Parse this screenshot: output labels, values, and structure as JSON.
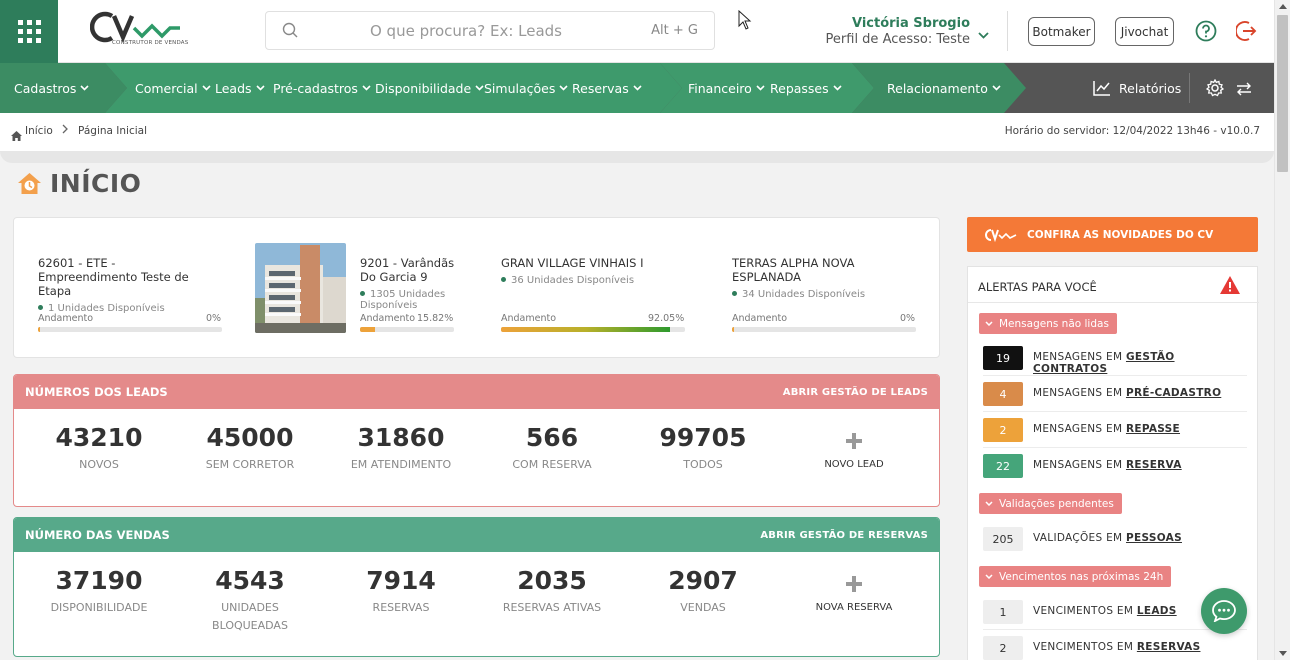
{
  "header": {
    "search_placeholder": "O que procura? Ex: Leads",
    "search_shortcut": "Alt + G",
    "logo_tagline": "CONSTRUTOR DE VENDAS",
    "user_name": "Victória Sbrogio",
    "user_profile": "Perfil de Acesso: Teste",
    "botmaker_label": "Botmaker",
    "jivochat_label": "Jivochat"
  },
  "nav": {
    "items": [
      "Cadastros",
      "Comercial",
      "Leads",
      "Pré-cadastros",
      "Disponibilidade",
      "Simulações",
      "Reservas",
      "Financeiro",
      "Repasses",
      "Relacionamento"
    ],
    "reports_label": "Relatórios"
  },
  "breadcrumb": {
    "home": "Início",
    "current": "Página Inicial",
    "server_time": "Horário do servidor: 12/04/2022 13h46 - v10.0.7"
  },
  "page": {
    "title": "INÍCIO"
  },
  "projects": [
    {
      "name": "62601 - ETE - Empreendimento Teste de Etapa",
      "units": "1 Unidades Disponíveis",
      "progress_label": "Andamento",
      "progress_text": "0%",
      "progress": 0.0
    },
    {
      "name": "9201 - Varândãs Do Garcia 9",
      "units": "1305 Unidades Disponíveis",
      "progress_label": "Andamento",
      "progress_text": "15.82%",
      "progress": 0.1582
    },
    {
      "name": "GRAN VILLAGE VINHAIS I",
      "units": "36 Unidades Disponíveis",
      "progress_label": "Andamento",
      "progress_text": "92.05%",
      "progress": 0.9205
    },
    {
      "name": "TERRAS ALPHA NOVA ESPLANADA",
      "units": "34 Unidades Disponíveis",
      "progress_label": "Andamento",
      "progress_text": "0%",
      "progress": 0.0
    }
  ],
  "leads": {
    "title": "NÚMEROS DOS LEADS",
    "link": "ABRIR GESTÃO DE LEADS",
    "stats": [
      {
        "value": "43210",
        "label": "NOVOS"
      },
      {
        "value": "45000",
        "label": "SEM CORRETOR"
      },
      {
        "value": "31860",
        "label": "EM ATENDIMENTO"
      },
      {
        "value": "566",
        "label": "COM RESERVA"
      },
      {
        "value": "99705",
        "label": "TODOS"
      }
    ],
    "new_label": "NOVO LEAD"
  },
  "sales": {
    "title": "NÚMERO DAS VENDAS",
    "link": "ABRIR GESTÃO DE RESERVAS",
    "stats": [
      {
        "value": "37190",
        "label": "DISPONIBILIDADE"
      },
      {
        "value": "4543",
        "label": "UNIDADES BLOQUEADAS"
      },
      {
        "value": "7914",
        "label": "RESERVAS"
      },
      {
        "value": "2035",
        "label": "RESERVAS ATIVAS"
      },
      {
        "value": "2907",
        "label": "VENDAS"
      }
    ],
    "new_label": "NOVA RESERVA"
  },
  "news_button": "CONFIRA AS NOVIDADES DO CV",
  "alerts": {
    "title": "ALERTAS PARA VOCÊ",
    "groups": [
      {
        "label": "Mensagens não lidas",
        "rows": [
          {
            "count": "19",
            "prefix": "MENSAGENS EM",
            "target": "GESTÃO CONTRATOS",
            "color": "#111111"
          },
          {
            "count": "4",
            "prefix": "MENSAGENS EM",
            "target": "PRÉ-CADASTRO",
            "color": "#d98b4a"
          },
          {
            "count": "2",
            "prefix": "MENSAGENS EM",
            "target": "REPASSE",
            "color": "#eda23a"
          },
          {
            "count": "22",
            "prefix": "MENSAGENS EM",
            "target": "RESERVA",
            "color": "#45a57a"
          }
        ]
      },
      {
        "label": "Validações pendentes",
        "rows": [
          {
            "count": "205",
            "prefix": "VALIDAÇÕES EM",
            "target": "PESSOAS",
            "color": "#eeeeee"
          }
        ]
      },
      {
        "label": "Vencimentos nas próximas 24h",
        "rows": [
          {
            "count": "1",
            "prefix": "VENCIMENTOS EM",
            "target": "LEADS",
            "color": "#eeeeee"
          },
          {
            "count": "2",
            "prefix": "VENCIMENTOS EM",
            "target": "RESERVAS",
            "color": "#eeeeee"
          }
        ]
      }
    ]
  },
  "colors": {
    "brand_green": "#2e7d5b",
    "nav_green": "#3e9a6c",
    "leads_red": "#e48a8a",
    "sales_green": "#57a98a",
    "news_orange": "#f47937"
  }
}
